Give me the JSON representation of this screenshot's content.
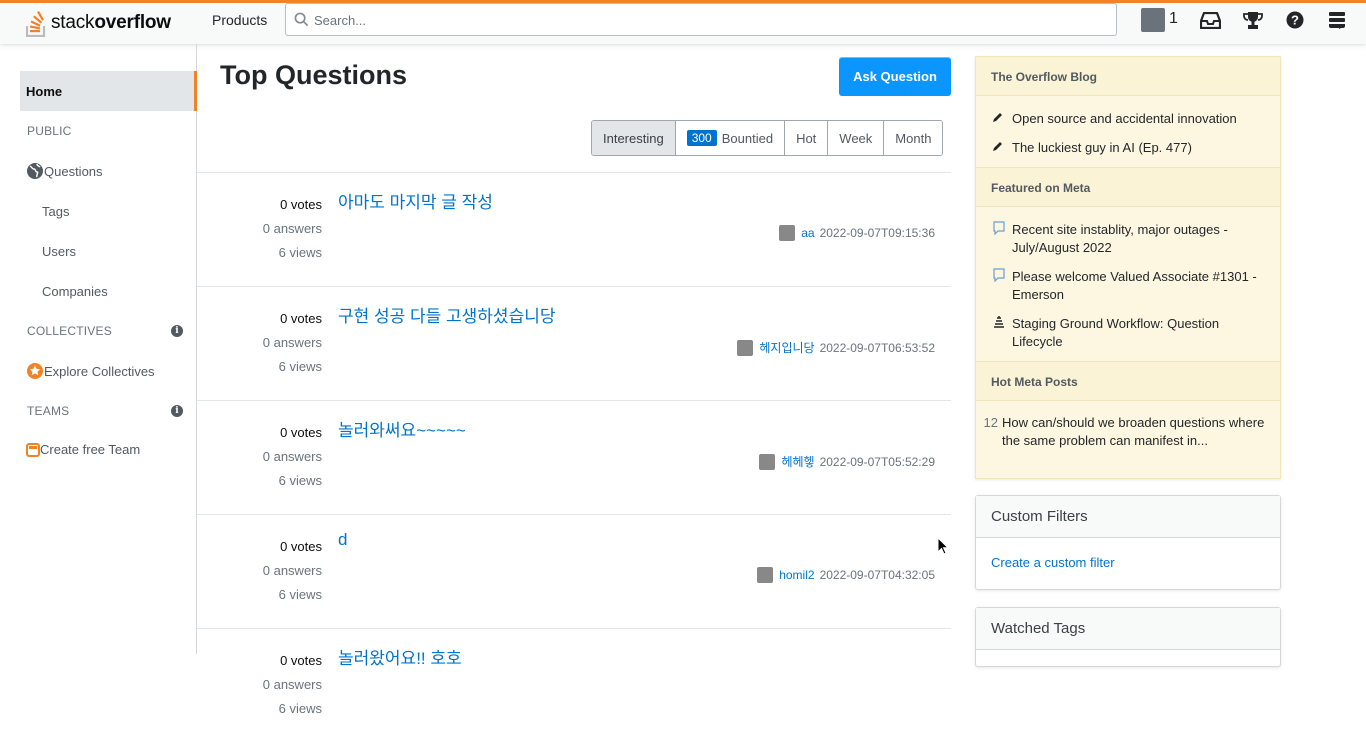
{
  "topbar": {
    "logo_plain": "stack",
    "logo_bold": "overflow",
    "products_label": "Products",
    "search_placeholder": "Search...",
    "reputation": "1"
  },
  "leftnav": {
    "home": "Home",
    "public": "PUBLIC",
    "questions": "Questions",
    "tags": "Tags",
    "users": "Users",
    "companies": "Companies",
    "collectives": "COLLECTIVES",
    "explore_collectives": "Explore Collectives",
    "teams": "TEAMS",
    "create_team": "Create free Team"
  },
  "main": {
    "title": "Top Questions",
    "ask_button": "Ask Question",
    "filters": {
      "interesting": "Interesting",
      "bounty_count": "300",
      "bountied": "Bountied",
      "hot": "Hot",
      "week": "Week",
      "month": "Month"
    },
    "questions": [
      {
        "votes": "0 votes",
        "answers": "0 answers",
        "views": "6 views",
        "title": "아마도 마지막 글 작성",
        "user": "aa",
        "time": "2022-09-07T09:15:36"
      },
      {
        "votes": "0 votes",
        "answers": "0 answers",
        "views": "6 views",
        "title": "구현 성공 다들 고생하셨습니당",
        "user": "헤지입니당",
        "time": "2022-09-07T06:53:52"
      },
      {
        "votes": "0 votes",
        "answers": "0 answers",
        "views": "6 views",
        "title": "놀러와써요~~~~~",
        "user": "헤헤헿",
        "time": "2022-09-07T05:52:29"
      },
      {
        "votes": "0 votes",
        "answers": "0 answers",
        "views": "6 views",
        "title": "d",
        "user": "homil2",
        "time": "2022-09-07T04:32:05"
      },
      {
        "votes": "0 votes",
        "answers": "0 answers",
        "views": "6 views",
        "title": "놀러왔어요!! 호호",
        "user": "",
        "time": ""
      }
    ]
  },
  "sidebar": {
    "blog_header": "The Overflow Blog",
    "blog_items": [
      "Open source and accidental innovation",
      "The luckiest guy in AI (Ep. 477)"
    ],
    "meta_header": "Featured on Meta",
    "meta_items": [
      "Recent site instablity, major outages - July/August 2022",
      "Please welcome Valued Associate #1301 - Emerson",
      "Staging Ground Workflow: Question Lifecycle"
    ],
    "hot_header": "Hot Meta Posts",
    "hot_items": [
      {
        "count": "12",
        "text": "How can/should we broaden questions where the same problem can manifest in..."
      }
    ],
    "custom_filters_title": "Custom Filters",
    "custom_filters_link": "Create a custom filter",
    "watched_tags_title": "Watched Tags"
  },
  "colors": {
    "accent": "#f48225",
    "link": "#0074cc",
    "ask_button": "#0a95ff"
  }
}
